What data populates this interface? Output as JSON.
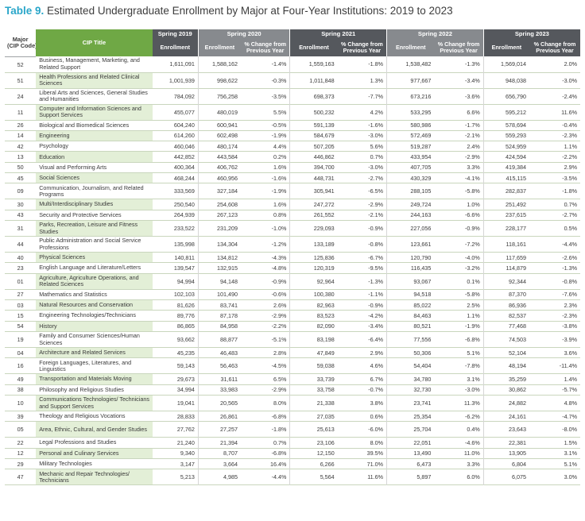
{
  "title": {
    "label": "Table 9.",
    "text": "Estimated Undergraduate Enrollment by Major at Four-Year Institutions: 2019 to 2023"
  },
  "columns": {
    "major_line1": "Major",
    "major_line2": "(CIP Code)",
    "cip_title": "CIP Title",
    "y2019": "Spring 2019",
    "y2020": "Spring 2020",
    "y2021": "Spring 2021",
    "y2022": "Spring 2022",
    "y2023": "Spring 2023",
    "enrollment": "Enrollment",
    "pct_line1": "% Change from",
    "pct_line2": "Previous Year"
  },
  "rows": [
    {
      "code": "52",
      "title": "Business, Management, Marketing, and Related Support",
      "e2019": "1,611,091",
      "e2020": "1,588,162",
      "p2020": "-1.4%",
      "e2021": "1,559,163",
      "p2021": "-1.8%",
      "e2022": "1,538,482",
      "p2022": "-1.3%",
      "e2023": "1,569,014",
      "p2023": "2.0%"
    },
    {
      "code": "51",
      "title": "Health Professions and Related Clinical Sciences",
      "e2019": "1,001,939",
      "e2020": "998,622",
      "p2020": "-0.3%",
      "e2021": "1,011,848",
      "p2021": "1.3%",
      "e2022": "977,667",
      "p2022": "-3.4%",
      "e2023": "948,038",
      "p2023": "-3.0%"
    },
    {
      "code": "24",
      "title": "Liberal Arts and Sciences, General Studies and Humanities",
      "e2019": "784,092",
      "e2020": "756,258",
      "p2020": "-3.5%",
      "e2021": "698,373",
      "p2021": "-7.7%",
      "e2022": "673,216",
      "p2022": "-3.6%",
      "e2023": "656,790",
      "p2023": "-2.4%"
    },
    {
      "code": "11",
      "title": "Computer and Information Sciences and Support Services",
      "e2019": "455,077",
      "e2020": "480,019",
      "p2020": "5.5%",
      "e2021": "500,232",
      "p2021": "4.2%",
      "e2022": "533,295",
      "p2022": "6.6%",
      "e2023": "595,212",
      "p2023": "11.6%"
    },
    {
      "code": "26",
      "title": "Biological and Biomedical Sciences",
      "e2019": "604,240",
      "e2020": "600,941",
      "p2020": "-0.5%",
      "e2021": "591,139",
      "p2021": "-1.6%",
      "e2022": "580,986",
      "p2022": "-1.7%",
      "e2023": "578,694",
      "p2023": "-0.4%"
    },
    {
      "code": "14",
      "title": "Engineering",
      "e2019": "614,260",
      "e2020": "602,498",
      "p2020": "-1.9%",
      "e2021": "584,679",
      "p2021": "-3.0%",
      "e2022": "572,469",
      "p2022": "-2.1%",
      "e2023": "559,293",
      "p2023": "-2.3%"
    },
    {
      "code": "42",
      "title": "Psychology",
      "e2019": "460,046",
      "e2020": "480,174",
      "p2020": "4.4%",
      "e2021": "507,205",
      "p2021": "5.6%",
      "e2022": "519,287",
      "p2022": "2.4%",
      "e2023": "524,959",
      "p2023": "1.1%"
    },
    {
      "code": "13",
      "title": "Education",
      "e2019": "442,852",
      "e2020": "443,584",
      "p2020": "0.2%",
      "e2021": "446,862",
      "p2021": "0.7%",
      "e2022": "433,954",
      "p2022": "-2.9%",
      "e2023": "424,594",
      "p2023": "-2.2%"
    },
    {
      "code": "50",
      "title": "Visual and Performing Arts",
      "e2019": "400,364",
      "e2020": "406,762",
      "p2020": "1.6%",
      "e2021": "394,700",
      "p2021": "-3.0%",
      "e2022": "407,705",
      "p2022": "3.3%",
      "e2023": "419,384",
      "p2023": "2.9%"
    },
    {
      "code": "45",
      "title": "Social Sciences",
      "e2019": "468,244",
      "e2020": "460,956",
      "p2020": "-1.6%",
      "e2021": "448,731",
      "p2021": "-2.7%",
      "e2022": "430,329",
      "p2022": "-4.1%",
      "e2023": "415,115",
      "p2023": "-3.5%"
    },
    {
      "code": "09",
      "title": "Communication, Journalism, and Related Programs",
      "e2019": "333,569",
      "e2020": "327,184",
      "p2020": "-1.9%",
      "e2021": "305,941",
      "p2021": "-6.5%",
      "e2022": "288,105",
      "p2022": "-5.8%",
      "e2023": "282,837",
      "p2023": "-1.8%"
    },
    {
      "code": "30",
      "title": "Multi/Interdisciplinary Studies",
      "e2019": "250,540",
      "e2020": "254,608",
      "p2020": "1.6%",
      "e2021": "247,272",
      "p2021": "-2.9%",
      "e2022": "249,724",
      "p2022": "1.0%",
      "e2023": "251,492",
      "p2023": "0.7%"
    },
    {
      "code": "43",
      "title": "Security and Protective Services",
      "e2019": "264,939",
      "e2020": "267,123",
      "p2020": "0.8%",
      "e2021": "261,552",
      "p2021": "-2.1%",
      "e2022": "244,163",
      "p2022": "-6.6%",
      "e2023": "237,615",
      "p2023": "-2.7%"
    },
    {
      "code": "31",
      "title": "Parks, Recreation, Leisure and Fitness Studies",
      "e2019": "233,522",
      "e2020": "231,209",
      "p2020": "-1.0%",
      "e2021": "229,093",
      "p2021": "-0.9%",
      "e2022": "227,056",
      "p2022": "-0.9%",
      "e2023": "228,177",
      "p2023": "0.5%"
    },
    {
      "code": "44",
      "title": "Public Administration and Social Service Professions",
      "e2019": "135,998",
      "e2020": "134,304",
      "p2020": "-1.2%",
      "e2021": "133,189",
      "p2021": "-0.8%",
      "e2022": "123,661",
      "p2022": "-7.2%",
      "e2023": "118,161",
      "p2023": "-4.4%"
    },
    {
      "code": "40",
      "title": "Physical Sciences",
      "e2019": "140,811",
      "e2020": "134,812",
      "p2020": "-4.3%",
      "e2021": "125,836",
      "p2021": "-6.7%",
      "e2022": "120,790",
      "p2022": "-4.0%",
      "e2023": "117,659",
      "p2023": "-2.6%"
    },
    {
      "code": "23",
      "title": "English Language and Literature/Letters",
      "e2019": "139,547",
      "e2020": "132,915",
      "p2020": "-4.8%",
      "e2021": "120,319",
      "p2021": "-9.5%",
      "e2022": "116,435",
      "p2022": "-3.2%",
      "e2023": "114,879",
      "p2023": "-1.3%"
    },
    {
      "code": "01",
      "title": "Agriculture, Agriculture Operations, and Related Sciences",
      "e2019": "94,994",
      "e2020": "94,148",
      "p2020": "-0.9%",
      "e2021": "92,964",
      "p2021": "-1.3%",
      "e2022": "93,067",
      "p2022": "0.1%",
      "e2023": "92,344",
      "p2023": "-0.8%"
    },
    {
      "code": "27",
      "title": "Mathematics and Statistics",
      "e2019": "102,103",
      "e2020": "101,490",
      "p2020": "-0.6%",
      "e2021": "100,380",
      "p2021": "-1.1%",
      "e2022": "94,518",
      "p2022": "-5.8%",
      "e2023": "87,370",
      "p2023": "-7.6%"
    },
    {
      "code": "03",
      "title": "Natural Resources and Conservation",
      "e2019": "81,626",
      "e2020": "83,741",
      "p2020": "2.6%",
      "e2021": "82,963",
      "p2021": "-0.9%",
      "e2022": "85,022",
      "p2022": "2.5%",
      "e2023": "86,936",
      "p2023": "2.3%"
    },
    {
      "code": "15",
      "title": "Engineering Technologies/Technicians",
      "e2019": "89,776",
      "e2020": "87,178",
      "p2020": "-2.9%",
      "e2021": "83,523",
      "p2021": "-4.2%",
      "e2022": "84,463",
      "p2022": "1.1%",
      "e2023": "82,537",
      "p2023": "-2.3%"
    },
    {
      "code": "54",
      "title": "History",
      "e2019": "86,865",
      "e2020": "84,958",
      "p2020": "-2.2%",
      "e2021": "82,090",
      "p2021": "-3.4%",
      "e2022": "80,521",
      "p2022": "-1.9%",
      "e2023": "77,468",
      "p2023": "-3.8%"
    },
    {
      "code": "19",
      "title": "Family and Consumer Sciences/Human Sciences",
      "e2019": "93,662",
      "e2020": "88,877",
      "p2020": "-5.1%",
      "e2021": "83,198",
      "p2021": "-6.4%",
      "e2022": "77,556",
      "p2022": "-6.8%",
      "e2023": "74,503",
      "p2023": "-3.9%"
    },
    {
      "code": "04",
      "title": "Architecture and Related Services",
      "e2019": "45,235",
      "e2020": "46,483",
      "p2020": "2.8%",
      "e2021": "47,849",
      "p2021": "2.9%",
      "e2022": "50,306",
      "p2022": "5.1%",
      "e2023": "52,104",
      "p2023": "3.6%"
    },
    {
      "code": "16",
      "title": "Foreign Languages, Literatures, and Linguistics",
      "e2019": "59,143",
      "e2020": "56,463",
      "p2020": "-4.5%",
      "e2021": "59,038",
      "p2021": "4.6%",
      "e2022": "54,404",
      "p2022": "-7.8%",
      "e2023": "48,194",
      "p2023": "-11.4%"
    },
    {
      "code": "49",
      "title": "Transportation and Materials Moving",
      "e2019": "29,673",
      "e2020": "31,611",
      "p2020": "6.5%",
      "e2021": "33,739",
      "p2021": "6.7%",
      "e2022": "34,780",
      "p2022": "3.1%",
      "e2023": "35,259",
      "p2023": "1.4%"
    },
    {
      "code": "38",
      "title": "Philosophy and Religious Studies",
      "e2019": "34,994",
      "e2020": "33,983",
      "p2020": "-2.9%",
      "e2021": "33,758",
      "p2021": "-0.7%",
      "e2022": "32,730",
      "p2022": "-3.0%",
      "e2023": "30,862",
      "p2023": "-5.7%"
    },
    {
      "code": "10",
      "title": "Communications Technologies/ Technicians and Support Services",
      "e2019": "19,041",
      "e2020": "20,565",
      "p2020": "8.0%",
      "e2021": "21,338",
      "p2021": "3.8%",
      "e2022": "23,741",
      "p2022": "11.3%",
      "e2023": "24,882",
      "p2023": "4.8%"
    },
    {
      "code": "39",
      "title": "Theology and Religious Vocations",
      "e2019": "28,833",
      "e2020": "26,861",
      "p2020": "-6.8%",
      "e2021": "27,035",
      "p2021": "0.6%",
      "e2022": "25,354",
      "p2022": "-6.2%",
      "e2023": "24,161",
      "p2023": "-4.7%"
    },
    {
      "code": "05",
      "title": "Area, Ethnic, Cultural, and Gender Studies",
      "e2019": "27,762",
      "e2020": "27,257",
      "p2020": "-1.8%",
      "e2021": "25,613",
      "p2021": "-6.0%",
      "e2022": "25,704",
      "p2022": "0.4%",
      "e2023": "23,643",
      "p2023": "-8.0%"
    },
    {
      "code": "22",
      "title": "Legal Professions and Studies",
      "e2019": "21,240",
      "e2020": "21,394",
      "p2020": "0.7%",
      "e2021": "23,106",
      "p2021": "8.0%",
      "e2022": "22,051",
      "p2022": "-4.6%",
      "e2023": "22,381",
      "p2023": "1.5%"
    },
    {
      "code": "12",
      "title": "Personal and Culinary Services",
      "e2019": "9,340",
      "e2020": "8,707",
      "p2020": "-6.8%",
      "e2021": "12,150",
      "p2021": "39.5%",
      "e2022": "13,490",
      "p2022": "11.0%",
      "e2023": "13,905",
      "p2023": "3.1%"
    },
    {
      "code": "29",
      "title": "Military Technologies",
      "e2019": "3,147",
      "e2020": "3,664",
      "p2020": "16.4%",
      "e2021": "6,266",
      "p2021": "71.0%",
      "e2022": "6,473",
      "p2022": "3.3%",
      "e2023": "6,804",
      "p2023": "5.1%"
    },
    {
      "code": "47",
      "title": "Mechanic and Repair Technologies/ Technicians",
      "e2019": "5,213",
      "e2020": "4,985",
      "p2020": "-4.4%",
      "e2021": "5,564",
      "p2021": "11.6%",
      "e2022": "5,897",
      "p2022": "6.0%",
      "e2023": "6,075",
      "p2023": "3.0%"
    }
  ]
}
